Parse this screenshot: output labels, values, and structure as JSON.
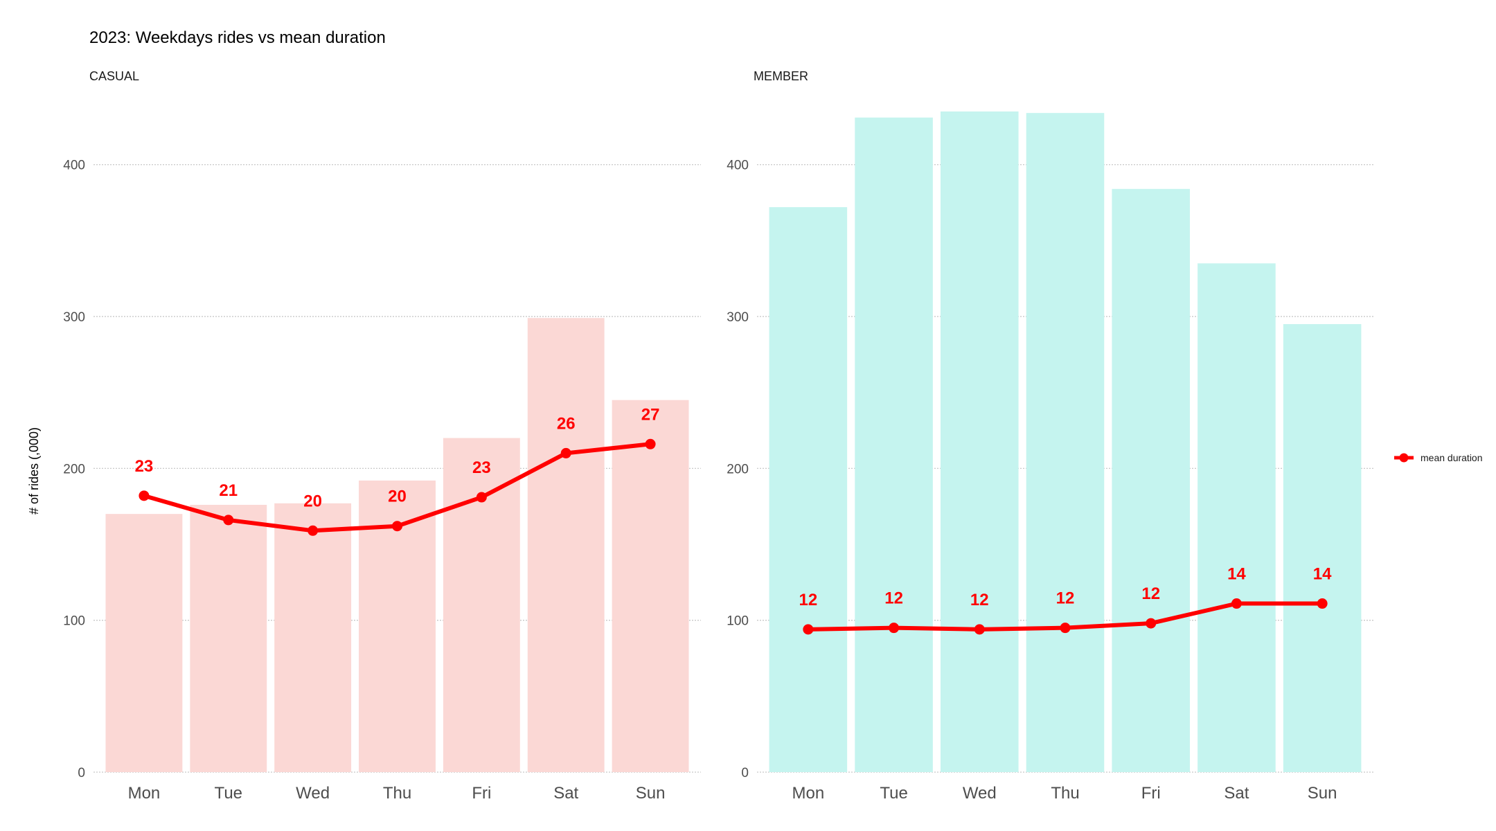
{
  "title": "2023: Weekdays rides vs mean duration",
  "ylabel": "# of rides (,000)",
  "legend": {
    "label": "mean duration",
    "position": "right"
  },
  "colors": {
    "casual_bar": "#fbd8d5",
    "member_bar": "#c5f4ef",
    "line": "#ff0000",
    "grid": "#c8c8c8"
  },
  "chart_data": [
    {
      "type": "bar",
      "panel": "CASUAL",
      "categories": [
        "Mon",
        "Tue",
        "Wed",
        "Thu",
        "Fri",
        "Sat",
        "Sun"
      ],
      "ylim": [
        0,
        440
      ],
      "yticks": [
        0,
        100,
        200,
        300,
        400
      ],
      "grid": true,
      "series": [
        {
          "values": [
            170,
            176,
            177,
            192,
            220,
            299,
            245
          ]
        },
        {
          "name": "mean duration",
          "type": "line",
          "values": [
            182,
            166,
            159,
            162,
            181,
            210,
            216
          ],
          "labels": [
            "23",
            "21",
            "20",
            "20",
            "23",
            "26",
            "27"
          ]
        }
      ]
    },
    {
      "type": "bar",
      "panel": "MEMBER",
      "categories": [
        "Mon",
        "Tue",
        "Wed",
        "Thu",
        "Fri",
        "Sat",
        "Sun"
      ],
      "ylim": [
        0,
        440
      ],
      "yticks": [
        0,
        100,
        200,
        300,
        400
      ],
      "grid": true,
      "series": [
        {
          "values": [
            372,
            431,
            435,
            434,
            384,
            335,
            295
          ]
        },
        {
          "name": "mean duration",
          "type": "line",
          "values": [
            94,
            95,
            94,
            95,
            98,
            111,
            111
          ],
          "labels": [
            "12",
            "12",
            "12",
            "12",
            "12",
            "14",
            "14"
          ]
        }
      ]
    }
  ]
}
